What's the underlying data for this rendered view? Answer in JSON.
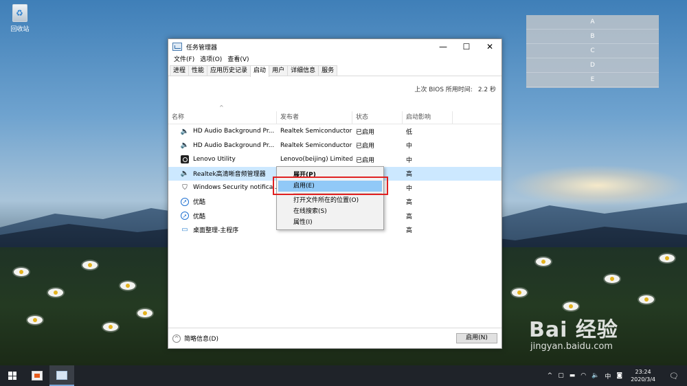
{
  "desktop": {
    "recycle_bin_label": "回收站",
    "right_box_items": [
      "A",
      "B",
      "C",
      "D",
      "E"
    ]
  },
  "window": {
    "title": "任务管理器",
    "controls": {
      "minimize": "—",
      "maximize": "☐",
      "close": "✕"
    },
    "menu": [
      "文件(F)",
      "选项(O)",
      "查看(V)"
    ],
    "tabs": [
      "进程",
      "性能",
      "应用历史记录",
      "启动",
      "用户",
      "详细信息",
      "服务"
    ],
    "active_tab": "启动",
    "bios_label": "上次 BIOS 所用时间:",
    "bios_value": "2.2 秒",
    "columns": [
      "名称",
      "发布者",
      "状态",
      "启动影响"
    ],
    "rows": [
      {
        "icon": "speaker-icon",
        "name": "HD Audio Background Pr...",
        "publisher": "Realtek Semiconductor",
        "status": "已启用",
        "impact": "低"
      },
      {
        "icon": "speaker-icon",
        "name": "HD Audio Background Pr...",
        "publisher": "Realtek Semiconductor",
        "status": "已启用",
        "impact": "中"
      },
      {
        "icon": "lenovo-icon",
        "name": "Lenovo Utility",
        "publisher": "Lenovo(beijing) Limited",
        "status": "已启用",
        "impact": "中"
      },
      {
        "icon": "speaker-icon",
        "name": "Realtek高清晰音频管理器",
        "publisher": "",
        "status": "",
        "impact": "高"
      },
      {
        "icon": "shield-icon",
        "name": "Windows Security notifica...",
        "publisher": "",
        "status": "",
        "impact": "中"
      },
      {
        "icon": "youku-icon",
        "name": "优酷",
        "publisher": "",
        "status": "",
        "impact": "高"
      },
      {
        "icon": "youku-icon",
        "name": "优酷",
        "publisher": "",
        "status": "",
        "impact": "高"
      },
      {
        "icon": "monitor-icon",
        "name": "桌面整理-主程序",
        "publisher": "",
        "status": "",
        "impact": "高"
      }
    ],
    "selected_row": 3,
    "footer_brief": "简略信息(D)",
    "footer_button": "启用(N)"
  },
  "context_menu": {
    "items": [
      "展开(P)",
      "启用(E)",
      "打开文件所在的位置(O)",
      "在线搜索(S)",
      "属性(I)"
    ],
    "highlighted": "启用(E)"
  },
  "watermark": {
    "line1": "Bai 经验",
    "line2": "jingyan.baidu.com"
  },
  "taskbar": {
    "ime": "中",
    "time": "23:24",
    "date": "2020/3/4"
  },
  "colors": {
    "selection": "#cce8ff",
    "menu_highlight": "#91c9f7",
    "annotation_red": "#e02020",
    "taskbar": "#1f2329"
  }
}
